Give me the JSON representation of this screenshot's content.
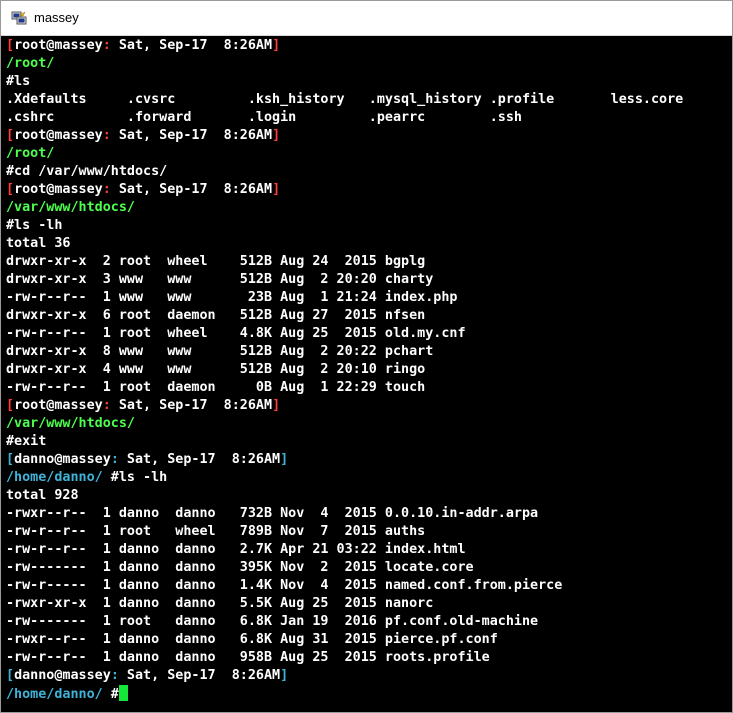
{
  "window": {
    "title": "massey",
    "icon": "putty-icon"
  },
  "colors": {
    "red": "#ff3b3b",
    "green": "#4dff4d",
    "cyan": "#3fb2d8",
    "cursor": "#15e63a"
  },
  "terminal": {
    "lines": [
      {
        "type": "prompt_root",
        "user": "root@massey",
        "date": ": Sat, Sep-17  8:26AM"
      },
      {
        "type": "path_root",
        "text": "/root/"
      },
      {
        "type": "text",
        "text": "#ls"
      },
      {
        "type": "text",
        "text": ".Xdefaults     .cvsrc         .ksh_history   .mysql_history .profile       less.core"
      },
      {
        "type": "text",
        "text": ".cshrc         .forward       .login         .pearrc        .ssh"
      },
      {
        "type": "prompt_root",
        "user": "root@massey",
        "date": ": Sat, Sep-17  8:26AM"
      },
      {
        "type": "path_root",
        "text": "/root/"
      },
      {
        "type": "text",
        "text": "#cd /var/www/htdocs/"
      },
      {
        "type": "prompt_root",
        "user": "root@massey",
        "date": ": Sat, Sep-17  8:26AM"
      },
      {
        "type": "path_root",
        "text": "/var/www/htdocs/"
      },
      {
        "type": "text",
        "text": "#ls -lh"
      },
      {
        "type": "text",
        "text": "total 36"
      },
      {
        "type": "text",
        "text": "drwxr-xr-x  2 root  wheel    512B Aug 24  2015 bgplg"
      },
      {
        "type": "text",
        "text": "drwxr-xr-x  3 www   www      512B Aug  2 20:20 charty"
      },
      {
        "type": "text",
        "text": "-rw-r--r--  1 www   www       23B Aug  1 21:24 index.php"
      },
      {
        "type": "text",
        "text": "drwxr-xr-x  6 root  daemon   512B Aug 27  2015 nfsen"
      },
      {
        "type": "text",
        "text": "-rw-r--r--  1 root  wheel    4.8K Aug 25  2015 old.my.cnf"
      },
      {
        "type": "text",
        "text": "drwxr-xr-x  8 www   www      512B Aug  2 20:22 pchart"
      },
      {
        "type": "text",
        "text": "drwxr-xr-x  4 www   www      512B Aug  2 20:10 ringo"
      },
      {
        "type": "text",
        "text": "-rw-r--r--  1 root  daemon     0B Aug  1 22:29 touch"
      },
      {
        "type": "prompt_root",
        "user": "root@massey",
        "date": ": Sat, Sep-17  8:26AM"
      },
      {
        "type": "path_root",
        "text": "/var/www/htdocs/"
      },
      {
        "type": "text",
        "text": "#exit"
      },
      {
        "type": "prompt_user",
        "user": "danno@massey",
        "date": ": Sat, Sep-17  8:26AM"
      },
      {
        "type": "path_user",
        "text": "/home/danno/",
        "cmd": " #ls -lh"
      },
      {
        "type": "text",
        "text": "total 928"
      },
      {
        "type": "text",
        "text": "-rwxr--r--  1 danno  danno   732B Nov  4  2015 0.0.10.in-addr.arpa"
      },
      {
        "type": "text",
        "text": "-rw-r--r--  1 root   wheel   789B Nov  7  2015 auths"
      },
      {
        "type": "text",
        "text": "-rw-r--r--  1 danno  danno   2.7K Apr 21 03:22 index.html"
      },
      {
        "type": "text",
        "text": "-rw-------  1 danno  danno   395K Nov  2  2015 locate.core"
      },
      {
        "type": "text",
        "text": "-rw-r-----  1 danno  danno   1.4K Nov  4  2015 named.conf.from.pierce"
      },
      {
        "type": "text",
        "text": "-rwxr-xr-x  1 danno  danno   5.5K Aug 25  2015 nanorc"
      },
      {
        "type": "text",
        "text": "-rw-------  1 root   danno   6.8K Jan 19  2016 pf.conf.old-machine"
      },
      {
        "type": "text",
        "text": "-rwxr--r--  1 danno  danno   6.8K Aug 31  2015 pierce.pf.conf"
      },
      {
        "type": "text",
        "text": "-rw-r--r--  1 danno  danno   958B Aug 25  2015 roots.profile"
      },
      {
        "type": "prompt_user",
        "user": "danno@massey",
        "date": ": Sat, Sep-17  8:26AM"
      },
      {
        "type": "path_user",
        "text": "/home/danno/",
        "cmd": " #",
        "cursor": true
      }
    ]
  }
}
